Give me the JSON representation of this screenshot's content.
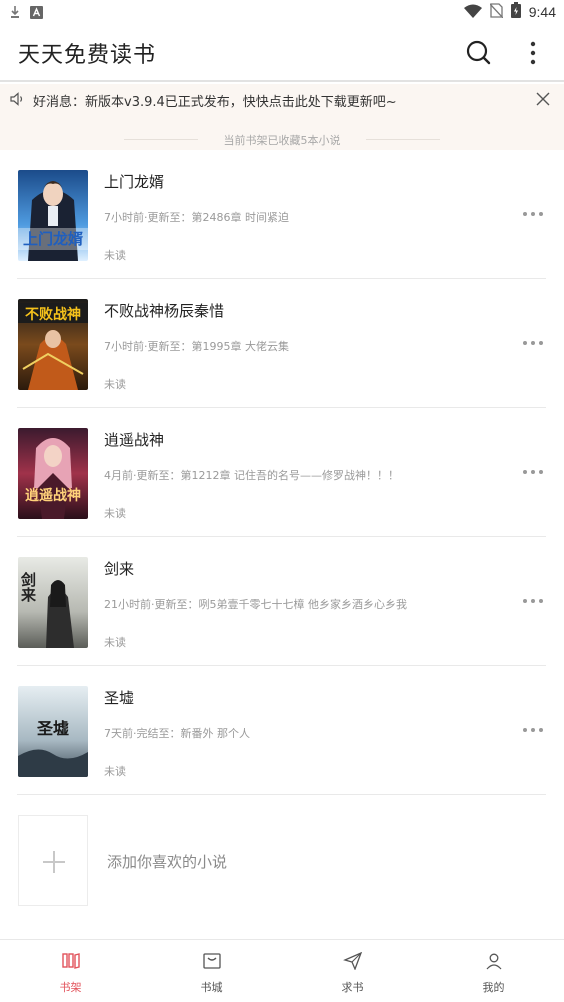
{
  "status_bar": {
    "time": "9:44",
    "icons": [
      "download-icon",
      "a-notification-icon",
      "wifi-icon",
      "no-sim-icon",
      "battery-icon"
    ]
  },
  "app_bar": {
    "title": "天天免费读书",
    "actions": [
      "search-icon",
      "more-vertical-icon"
    ]
  },
  "notice": {
    "text": "好消息：新版本v3.9.4已正式发布，快快点击此处下载更新吧~",
    "icon": "speaker-icon",
    "close_icon": "close-icon"
  },
  "shelf": {
    "count_text": "当前书架已收藏5本小说"
  },
  "books": [
    {
      "title": "上门龙婿",
      "update": "7小时前·更新至：第2486章 时间紧迫",
      "status": "未读",
      "cover_color": "#3a7fc4",
      "cover_text": "上门龙婿"
    },
    {
      "title": "不败战神杨辰秦惜",
      "update": "7小时前·更新至：第1995章 大佬云集",
      "status": "未读",
      "cover_color": "#6e4a1e",
      "cover_text": "不败战神"
    },
    {
      "title": "逍遥战神",
      "update": "4月前·更新至：第1212章 记住吾的名号——修罗战神！！！",
      "status": "未读",
      "cover_color": "#7b2b3a",
      "cover_text": "逍遥战神"
    },
    {
      "title": "剑来",
      "update": "21小时前·更新至：咧5弟壹千零七十七樟 他乡家乡酒乡心乡我",
      "status": "未读",
      "cover_color": "#c9ccc4",
      "cover_text": "剑来"
    },
    {
      "title": "圣墟",
      "update": "7天前·完结至：新番外 那个人",
      "status": "未读",
      "cover_color": "#9fb1bb",
      "cover_text": "圣墟"
    }
  ],
  "add_book": {
    "label": "添加你喜欢的小说",
    "icon": "plus-icon"
  },
  "bottom_nav": [
    {
      "label": "书架",
      "icon": "bookshelf-icon",
      "active": true
    },
    {
      "label": "书城",
      "icon": "bookstore-icon",
      "active": false
    },
    {
      "label": "求书",
      "icon": "paper-plane-icon",
      "active": false
    },
    {
      "label": "我的",
      "icon": "user-icon",
      "active": false
    }
  ],
  "colors": {
    "accent": "#e2535b",
    "notice_bg": "#fbf6f2",
    "muted_text": "#9a9a9a"
  }
}
